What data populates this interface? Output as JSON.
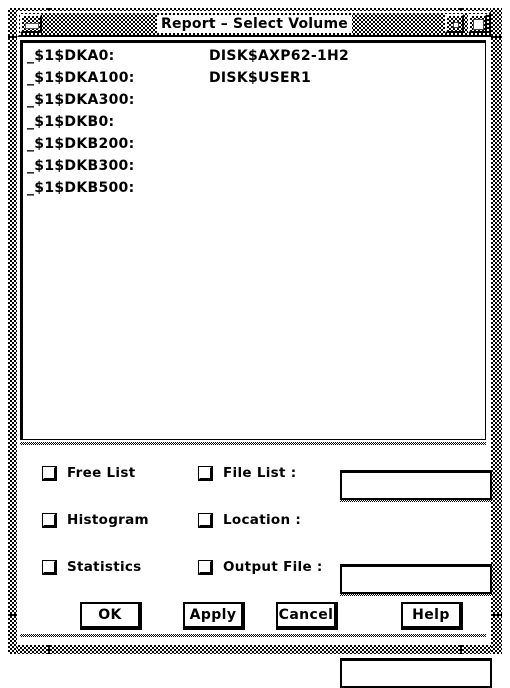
{
  "window": {
    "title": "Report – Select Volume",
    "menu_button": "window-menu",
    "minimize_label": "Minimize",
    "maximize_label": "Maximize"
  },
  "list": {
    "items": [
      {
        "device": "_$1$DKA0:",
        "label": "DISK$AXP62-1H2"
      },
      {
        "device": "_$1$DKA100:",
        "label": "DISK$USER1"
      },
      {
        "device": "_$1$DKA300:",
        "label": ""
      },
      {
        "device": "_$1$DKB0:",
        "label": ""
      },
      {
        "device": "_$1$DKB200:",
        "label": ""
      },
      {
        "device": "_$1$DKB300:",
        "label": ""
      },
      {
        "device": "_$1$DKB500:",
        "label": ""
      }
    ]
  },
  "options": {
    "checkboxes": [
      {
        "name": "free-list",
        "label": "Free List",
        "checked": false
      },
      {
        "name": "file-list",
        "label": "File List :",
        "checked": false
      },
      {
        "name": "histogram",
        "label": "Histogram",
        "checked": false
      },
      {
        "name": "location",
        "label": "Location :",
        "checked": false
      },
      {
        "name": "statistics",
        "label": "Statistics",
        "checked": false
      },
      {
        "name": "output-file",
        "label": "Output File :",
        "checked": false
      }
    ],
    "fields": [
      {
        "name": "file-list-field",
        "value": "",
        "placeholder": ""
      },
      {
        "name": "location-field",
        "value": "",
        "placeholder": ""
      },
      {
        "name": "output-file-field",
        "value": "",
        "placeholder": ""
      }
    ]
  },
  "buttons": {
    "ok": "OK",
    "apply": "Apply",
    "cancel": "Cancel",
    "help": "Help"
  },
  "colors": {
    "background": "#ffffff",
    "foreground": "#000000"
  }
}
